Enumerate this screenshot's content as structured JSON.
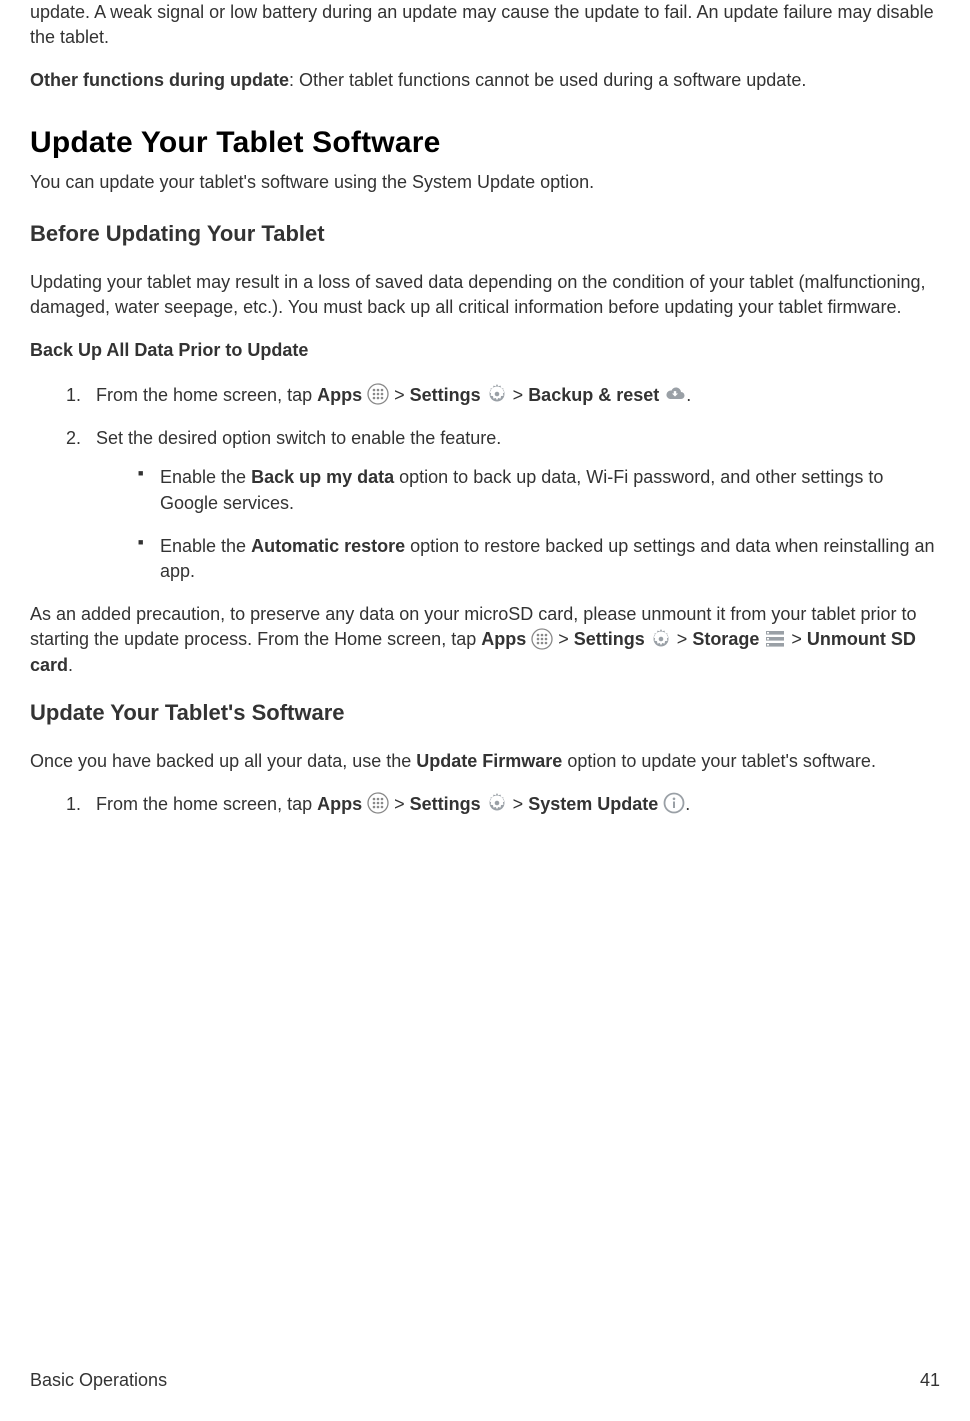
{
  "intro": {
    "p1": "update. A weak signal or low battery during an update may cause the update to fail. An update failure may disable the tablet.",
    "other_label": "Other functions during update",
    "other_text": ": Other tablet functions cannot be used during a software update."
  },
  "h1": "Update Your Tablet Software",
  "h1_sub": "You can update your tablet's software using the System Update option.",
  "sec1": {
    "h2": "Before Updating Your Tablet",
    "p1": "Updating your tablet may result in a loss of saved data depending on the condition of your tablet (malfunctioning, damaged, water seepage, etc.). You must back up all critical information before updating your tablet firmware.",
    "h3": "Back Up All Data Prior to Update",
    "step1_a": "From the home screen, tap ",
    "apps": "Apps",
    "gt": " > ",
    "settings": "Settings",
    "backup_reset": "Backup & reset",
    "period": ".",
    "step2": "Set the desired option switch to enable the feature.",
    "bullet1_a": "Enable the ",
    "bullet1_b": "Back up my data",
    "bullet1_c": " option to back up data, Wi-Fi password, and other settings to Google services.",
    "bullet2_a": "Enable the ",
    "bullet2_b": "Automatic restore",
    "bullet2_c": " option to restore backed up settings and data when reinstalling an app.",
    "p2_a": "As an added precaution, to preserve any data on your microSD card, please unmount it from your tablet prior to starting the update process. From the Home screen, tap ",
    "storage": "Storage",
    "unmount": "Unmount SD card"
  },
  "sec2": {
    "h2": "Update Your Tablet's Software",
    "p1_a": "Once you have backed up all your data, use the ",
    "p1_b": "Update Firmware",
    "p1_c": " option to update your tablet's software.",
    "step1_a": "From the home screen, tap ",
    "system_update": "System Update"
  },
  "footer": {
    "title": "Basic Operations",
    "page": "41"
  }
}
